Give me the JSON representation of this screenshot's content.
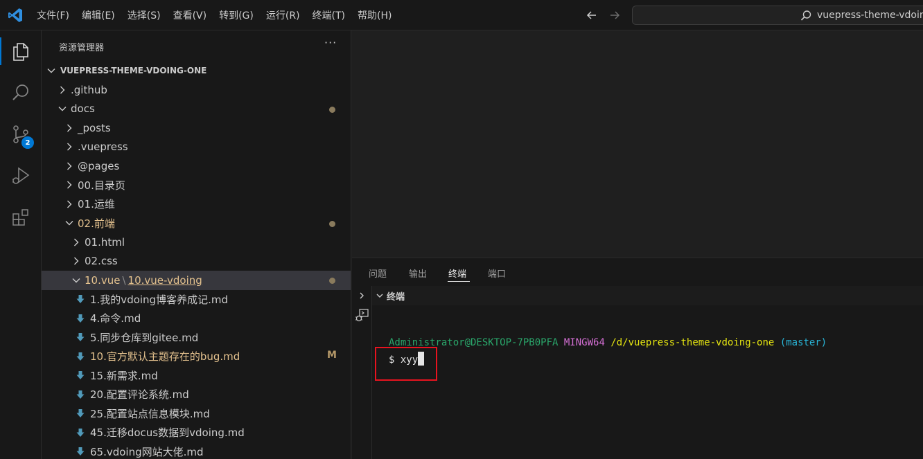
{
  "menu": [
    "文件(F)",
    "编辑(E)",
    "选择(S)",
    "查看(V)",
    "转到(G)",
    "运行(R)",
    "终端(T)",
    "帮助(H)"
  ],
  "search": {
    "text": "vuepress-theme-vdoing"
  },
  "activity": {
    "source_control_badge": "2"
  },
  "sidebar": {
    "title": "资源管理器",
    "more": "···",
    "root": "VUEPRESS-THEME-VDOING-ONE",
    "items": [
      {
        "label": ".github",
        "indent": 0,
        "type": "folder-closed",
        "status": ""
      },
      {
        "label": "docs",
        "indent": 0,
        "type": "folder-open",
        "status": "dot"
      },
      {
        "label": "_posts",
        "indent": 1,
        "type": "folder-closed",
        "status": ""
      },
      {
        "label": ".vuepress",
        "indent": 1,
        "type": "folder-closed",
        "status": ""
      },
      {
        "label": "@pages",
        "indent": 1,
        "type": "folder-closed",
        "status": ""
      },
      {
        "label": "00.目录页",
        "indent": 1,
        "type": "folder-closed",
        "status": ""
      },
      {
        "label": "01.运维",
        "indent": 1,
        "type": "folder-closed",
        "status": ""
      },
      {
        "label": "02.前端",
        "indent": 1,
        "type": "folder-open",
        "status": "dot",
        "modified": true
      },
      {
        "label": "01.html",
        "indent": 2,
        "type": "folder-closed",
        "status": ""
      },
      {
        "label": "02.css",
        "indent": 2,
        "type": "folder-closed",
        "status": ""
      },
      {
        "label": "10.vue",
        "label2": "10.vue-vdoing",
        "indent": 2,
        "type": "folder-open",
        "status": "dot",
        "modified": true,
        "selected": true
      },
      {
        "label": "1.我的vdoing博客养成记.md",
        "indent": 3,
        "type": "file",
        "status": ""
      },
      {
        "label": "4.命令.md",
        "indent": 3,
        "type": "file",
        "status": ""
      },
      {
        "label": "5.同步仓库到gitee.md",
        "indent": 3,
        "type": "file",
        "status": ""
      },
      {
        "label": "10.官方默认主题存在的bug.md",
        "indent": 3,
        "type": "file",
        "status": "M",
        "modified": true
      },
      {
        "label": "15.新需求.md",
        "indent": 3,
        "type": "file",
        "status": ""
      },
      {
        "label": "20.配置评论系统.md",
        "indent": 3,
        "type": "file",
        "status": ""
      },
      {
        "label": "25.配置站点信息模块.md",
        "indent": 3,
        "type": "file",
        "status": ""
      },
      {
        "label": "45.迁移docus数据到vdoing.md",
        "indent": 3,
        "type": "file",
        "status": ""
      },
      {
        "label": "65.vdoing网站大佬.md",
        "indent": 3,
        "type": "file",
        "status": ""
      }
    ]
  },
  "panel": {
    "tabs": [
      "问题",
      "输出",
      "终端",
      "端口"
    ],
    "active_tab": "终端",
    "section_label": "终端"
  },
  "terminal": {
    "user": "Administrator@DESKTOP-7PB0PFA",
    "shell": "MINGW64",
    "path": "/d/vuepress-theme-vdoing-one",
    "branch": "(master)",
    "prompt": "$",
    "command": "xyy"
  },
  "colors": {
    "accent": "#0078d4",
    "modified": "#e2c08d",
    "highlight_box": "#e8131f"
  }
}
